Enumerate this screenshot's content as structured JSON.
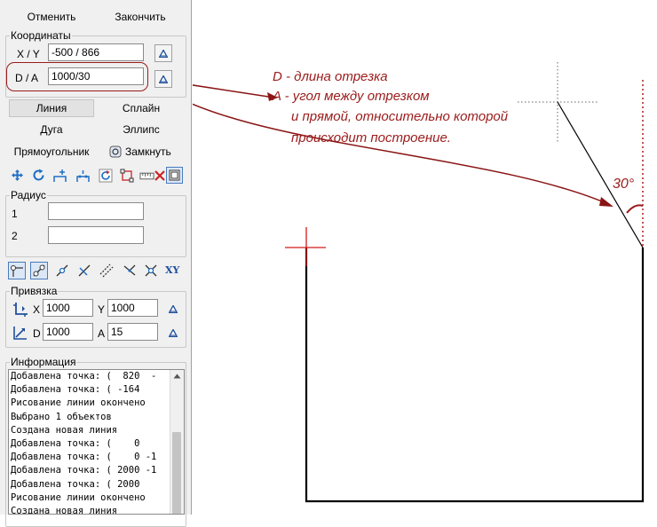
{
  "toolbar": {
    "cancel_label": "Отменить",
    "finish_label": "Закончить"
  },
  "coords": {
    "title": "Координаты",
    "xy_label": "X / Y",
    "xy_value": "-500 / 866",
    "da_label": "D / A",
    "da_value": "1000/30"
  },
  "modes": {
    "line": "Линия",
    "spline": "Сплайн",
    "arc": "Дуга",
    "ellipse": "Эллипс",
    "rectangle": "Прямоугольник",
    "close": "Замкнуть"
  },
  "radius": {
    "title": "Радиус",
    "label_1": "1",
    "label_2": "2",
    "value_1": "",
    "value_2": ""
  },
  "snap": {
    "title": "Привязка",
    "x_label": "X",
    "x_value": "1000",
    "y_label": "Y",
    "y_value": "1000",
    "d_label": "D",
    "d_value": "1000",
    "a_label": "A",
    "a_value": "15",
    "xy_button": "XY"
  },
  "info": {
    "title": "Информация",
    "lines": [
      "Добавлена точка: (  820  -",
      "Добавлена точка: ( -164",
      "Рисование линии окончено",
      "Выбрано 1 объектов",
      "Создана новая линия",
      "Добавлена точка: (    0",
      "Добавлена точка: (    0 -1",
      "Добавлена точка: ( 2000 -1",
      "Добавлена точка: ( 2000",
      "Рисование линии окончено",
      "Создана новая линия"
    ]
  },
  "annotations": {
    "line_1": "D - длина отрезка",
    "line_2": "A - угол между отрезком",
    "line_3": "и прямой, относительно которой",
    "line_4": "происходит построение.",
    "angle": "30°"
  },
  "colors": {
    "annotation": "#9b1b1b",
    "accent_blue": "#1f6fc5",
    "delete_red": "#cc2222",
    "crosshair_red": "#d11a1a"
  },
  "icons": [
    "move-icon",
    "rotate-icon",
    "add-point-icon",
    "insert-point-icon",
    "refresh-icon",
    "select-box-icon",
    "ruler-icon",
    "delete-icon",
    "view-icon",
    "snap-point-icon",
    "snap-end-icon",
    "snap-mid-icon",
    "snap-line-icon",
    "snap-parallel-icon",
    "snap-angle-icon",
    "snap-intersection-icon",
    "triangle-icon"
  ]
}
